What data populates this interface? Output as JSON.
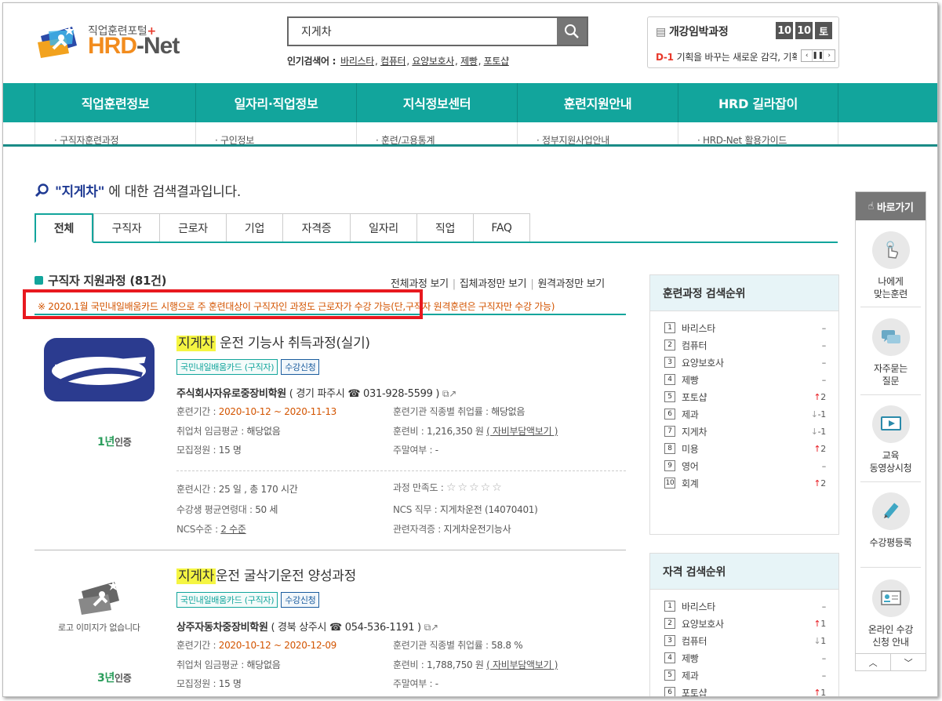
{
  "header": {
    "logo_sub": "직업훈련포털",
    "logo_plus": "+",
    "logo_main": "HRD",
    "logo_dash": "-Net",
    "search_value": "지게차",
    "popular_label": "인기검색어 :",
    "popular_terms": [
      "바리스타",
      "컴퓨터",
      "요양보호사",
      "제빵",
      "포토샵"
    ]
  },
  "upcoming": {
    "title": "개강임박과정",
    "date": [
      "10",
      "10",
      "토"
    ],
    "dday": "D-1",
    "course": "기획을 바꾸는 새로운 감각, 기획"
  },
  "gnb": [
    "직업훈련정보",
    "일자리·직업정보",
    "지식정보센터",
    "훈련지원안내",
    "HRD 길라잡이"
  ],
  "gnb_sub": [
    "· 구직자훈련과정",
    "· 구인정보",
    "· 훈련/고용통계",
    "· 정부지원사업안내",
    "· HRD-Net 활용가이드"
  ],
  "result": {
    "keyword": "\"지게차\"",
    "suffix": " 에 대한 검색결과입니다."
  },
  "tabs": [
    "전체",
    "구직자",
    "근로자",
    "기업",
    "자격증",
    "일자리",
    "직업",
    "FAQ"
  ],
  "section": {
    "title": "구직자 지원과정 (81건)",
    "views": [
      "전체과정 보기",
      "집체과정만 보기",
      "원격과정만 보기"
    ],
    "notice": "※ 2020.1월 국민내일배움카드 시행으로 주 훈련대상이 구직자인 과정도 근로자가 수강 가능(단,구직자 원격훈련은 구직자만 수강 가능)"
  },
  "courses": [
    {
      "title_hl": "지게차",
      "title_rest": " 운전 기능사 취득과정(실기)",
      "badges": [
        "국민내일배움카드 (구직자)",
        "수강신청"
      ],
      "cert_num": "1년",
      "cert_label": "인증",
      "inst": "주식회사자유로중장비학원",
      "inst_extra": " ( 경기 파주시 ☎ 031-928-5599 )",
      "period_label": "훈련기간 : ",
      "period": "2020-10-12 ~ 2020-11-13",
      "emp_label": "훈련기관 직종별 취업률 : ",
      "emp": "해당없음",
      "wage_label": "취업처 임금평균 : ",
      "wage": "해당없음",
      "fee_label": "훈련비 : ",
      "fee": "1,216,350 원",
      "fee_link": "( 자비부담액보기 )",
      "cap_label": "모집정원 : ",
      "cap": "15 명",
      "weekend_label": "주말여부 : ",
      "weekend": "-",
      "hours_label": "훈련시간 : ",
      "hours": "25 일 , 총 170 시간",
      "sat_label": "과정 만족도 : ",
      "stars": "☆☆☆☆☆",
      "age_label": "수강생 평균연령대 : ",
      "age": "50 세",
      "ncs_label": "NCS 직무 : ",
      "ncs": "지게차운전 (14070401)",
      "level_label": "NCS수준 : ",
      "level": "2 수준",
      "lic_label": "관련자격증 : ",
      "lic": "지게차운전기능사"
    },
    {
      "title_hl": "지게차",
      "title_rest": "운전 굴삭기운전 양성과정",
      "badges": [
        "국민내일배움카드 (구직자)",
        "수강신청"
      ],
      "nologo": "로고 이미지가 없습니다",
      "cert_num": "3년",
      "cert_label": "인증",
      "inst": "상주자동차중장비학원",
      "inst_extra": " ( 경북 상주시 ☎ 054-536-1191 )",
      "period_label": "훈련기간 : ",
      "period": "2020-10-12 ~ 2020-12-09",
      "emp_label": "훈련기관 직종별 취업률 : ",
      "emp": "58.8 %",
      "wage_label": "취업처 임금평균 : ",
      "wage": "해당없음",
      "fee_label": "훈련비 : ",
      "fee": "1,788,750 원",
      "fee_link": "( 자비부담액보기 )",
      "cap_label": "모집정원 : ",
      "cap": "15 명",
      "weekend_label": "주말여부 : ",
      "weekend": "-"
    }
  ],
  "rank_course": {
    "title": "훈련과정 검색순위",
    "items": [
      {
        "n": "1",
        "name": "바리스타",
        "dir": "",
        "ch": "–"
      },
      {
        "n": "2",
        "name": "컴퓨터",
        "dir": "",
        "ch": "–"
      },
      {
        "n": "3",
        "name": "요양보호사",
        "dir": "",
        "ch": "–"
      },
      {
        "n": "4",
        "name": "제빵",
        "dir": "",
        "ch": "–"
      },
      {
        "n": "5",
        "name": "포토샵",
        "dir": "up",
        "ch": "2"
      },
      {
        "n": "6",
        "name": "제과",
        "dir": "dn",
        "ch": "-1"
      },
      {
        "n": "7",
        "name": "지게차",
        "dir": "dn",
        "ch": "-1"
      },
      {
        "n": "8",
        "name": "미용",
        "dir": "up",
        "ch": "2"
      },
      {
        "n": "9",
        "name": "영어",
        "dir": "",
        "ch": "–"
      },
      {
        "n": "10",
        "name": "회계",
        "dir": "up",
        "ch": "2"
      }
    ]
  },
  "rank_license": {
    "title": "자격 검색순위",
    "items": [
      {
        "n": "1",
        "name": "바리스타",
        "dir": "",
        "ch": "–"
      },
      {
        "n": "2",
        "name": "요양보호사",
        "dir": "up",
        "ch": "1"
      },
      {
        "n": "3",
        "name": "컴퓨터",
        "dir": "dn",
        "ch": "1"
      },
      {
        "n": "4",
        "name": "제빵",
        "dir": "",
        "ch": "–"
      },
      {
        "n": "5",
        "name": "제과",
        "dir": "",
        "ch": "–"
      },
      {
        "n": "6",
        "name": "포토샵",
        "dir": "up",
        "ch": "1"
      }
    ]
  },
  "quick": {
    "title": "바로가기",
    "items": [
      "나에게\n맞는훈련",
      "자주묻는\n질문",
      "교육\n동영상시청",
      "수강평등록",
      "온라인 수강\n신청 안내"
    ]
  },
  "colors": {
    "teal": "#12a59c",
    "orange": "#d35400",
    "red": "#e8191f",
    "highlight": "#f5f542"
  }
}
